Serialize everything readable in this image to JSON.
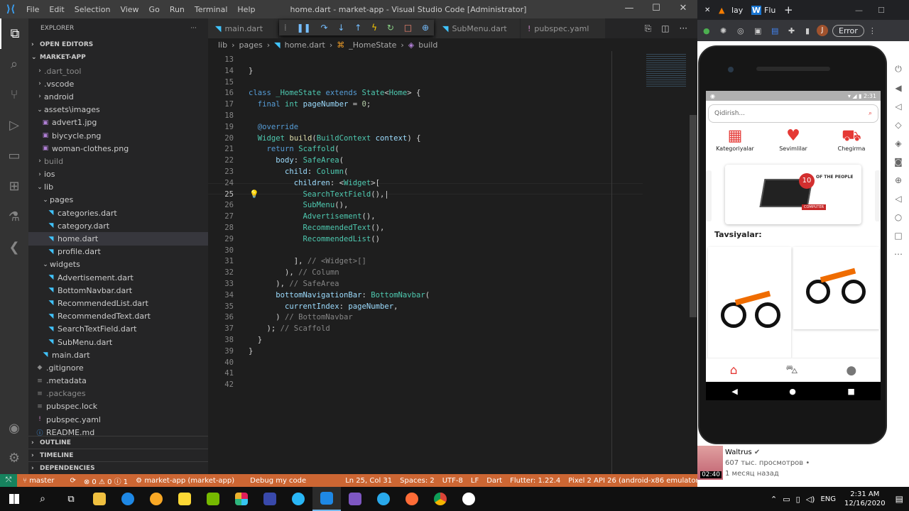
{
  "window": {
    "title": "home.dart - market-app - Visual Studio Code [Administrator]",
    "menu": [
      "File",
      "Edit",
      "Selection",
      "View",
      "Go",
      "Run",
      "Terminal",
      "Help"
    ]
  },
  "sidebar": {
    "header": "EXPLORER",
    "more": "···",
    "open_editors": "OPEN EDITORS",
    "project": "MARKET-APP",
    "outline": "OUTLINE",
    "timeline": "TIMELINE",
    "dependencies": "DEPENDENCIES",
    "tree": [
      {
        "label": ".dart_tool",
        "indent": 1,
        "type": "folder",
        "open": false,
        "dim": true
      },
      {
        "label": ".vscode",
        "indent": 1,
        "type": "folder",
        "open": false
      },
      {
        "label": "android",
        "indent": 1,
        "type": "folder",
        "open": false
      },
      {
        "label": "assets\\images",
        "indent": 1,
        "type": "folder",
        "open": true
      },
      {
        "label": "advert1.jpg",
        "indent": 2,
        "type": "img"
      },
      {
        "label": "biycycle.png",
        "indent": 2,
        "type": "img"
      },
      {
        "label": "woman-clothes.png",
        "indent": 2,
        "type": "img"
      },
      {
        "label": "build",
        "indent": 1,
        "type": "folder",
        "open": false,
        "dim": true
      },
      {
        "label": "ios",
        "indent": 1,
        "type": "folder",
        "open": false
      },
      {
        "label": "lib",
        "indent": 1,
        "type": "folder",
        "open": true
      },
      {
        "label": "pages",
        "indent": 2,
        "type": "folder",
        "open": true
      },
      {
        "label": "categories.dart",
        "indent": 3,
        "type": "dart"
      },
      {
        "label": "category.dart",
        "indent": 3,
        "type": "dart"
      },
      {
        "label": "home.dart",
        "indent": 3,
        "type": "dart",
        "selected": true
      },
      {
        "label": "profile.dart",
        "indent": 3,
        "type": "dart"
      },
      {
        "label": "widgets",
        "indent": 2,
        "type": "folder",
        "open": true
      },
      {
        "label": "Advertisement.dart",
        "indent": 3,
        "type": "dart"
      },
      {
        "label": "BottomNavbar.dart",
        "indent": 3,
        "type": "dart"
      },
      {
        "label": "RecommendedList.dart",
        "indent": 3,
        "type": "dart"
      },
      {
        "label": "RecommendedText.dart",
        "indent": 3,
        "type": "dart"
      },
      {
        "label": "SearchTextField.dart",
        "indent": 3,
        "type": "dart"
      },
      {
        "label": "SubMenu.dart",
        "indent": 3,
        "type": "dart"
      },
      {
        "label": "main.dart",
        "indent": 2,
        "type": "dart"
      },
      {
        "label": ".gitignore",
        "indent": 1,
        "type": "git"
      },
      {
        "label": ".metadata",
        "indent": 1,
        "type": "meta"
      },
      {
        "label": ".packages",
        "indent": 1,
        "type": "meta",
        "dim": true
      },
      {
        "label": "pubspec.lock",
        "indent": 1,
        "type": "meta"
      },
      {
        "label": "pubspec.yaml",
        "indent": 1,
        "type": "yaml"
      },
      {
        "label": "README.md",
        "indent": 1,
        "type": "md"
      }
    ]
  },
  "tabs": [
    {
      "label": "main.dart"
    },
    {
      "label": "SubMenu.dart"
    },
    {
      "label": "pubspec.yaml"
    }
  ],
  "breadcrumb": [
    "lib",
    "›",
    "pages",
    "›",
    "home.dart",
    "›",
    "_HomeState",
    "›",
    "build"
  ],
  "status": {
    "branch": "master",
    "errors": "⊗ 0 ⚠ 0 ⓘ 1",
    "app": "market-app (market-app)",
    "debug": "Debug my code",
    "position": "Ln 25, Col 31",
    "spaces": "Spaces: 2",
    "encoding": "UTF-8",
    "eol": "LF",
    "lang": "Dart",
    "flutter": "Flutter: 1.22.4",
    "device": "Pixel 2 API 26 (android-x86 emulator)"
  },
  "browser": {
    "tab1": "lay",
    "tab2": "Flu",
    "error_btn": "Error",
    "avatar": "J"
  },
  "phone": {
    "time": "2:31",
    "search_placeholder": "Qidirish...",
    "menu": [
      "Kategoriyalar",
      "Sevimlilar",
      "Chegirma"
    ],
    "ad_text1": "OF THE PEOPLE",
    "ad_badge": "COMPUTER",
    "section": "Tavsiyalar:"
  },
  "video": {
    "channel": "Waltrus",
    "views": "607 тыс. просмотров •",
    "date": "1 месяц назад",
    "duration": "02:40"
  },
  "taskbar": {
    "lang": "ENG",
    "time": "2:31 AM",
    "date": "12/16/2020"
  },
  "colors": {
    "accent": "#cc6633",
    "phone_red": "#e53935"
  }
}
